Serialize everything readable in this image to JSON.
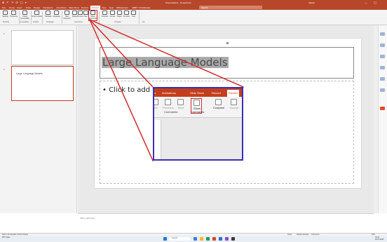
{
  "window": {
    "quick_access": "⊞ ↶ ↷ ⟳ ▢ ▾",
    "doc_title": "Presentation1 - PowerPoint",
    "user": "Sakshi",
    "window_controls": "— ▢ ✕"
  },
  "menu": {
    "tabs": [
      "File",
      "Home",
      "Insert",
      "Draw",
      "Design",
      "Transitions",
      "Animations",
      "Slide Show",
      "Record",
      "Review",
      "View",
      "Help",
      "PDFelement",
      "ABBYY FineReader"
    ],
    "active_index": 9,
    "search_placeholder": "Search"
  },
  "ribbon": {
    "buttons": [
      {
        "label": "Spelling"
      },
      {
        "label": "Thesaurus"
      },
      {
        "label": "Check Accessibility"
      },
      {
        "label": "Smart Lookup"
      },
      {
        "label": "Translate"
      },
      {
        "label": "Language"
      },
      {
        "label": "New Comment"
      },
      {
        "label": "Delete"
      },
      {
        "label": "Previous"
      },
      {
        "label": "Next"
      },
      {
        "label": "Show Comments"
      },
      {
        "label": "Compare"
      },
      {
        "label": "Accept"
      },
      {
        "label": "Reject"
      },
      {
        "label": "Previous"
      },
      {
        "label": "Next"
      }
    ],
    "groups": [
      "Proofing",
      "Accessibility",
      "Insights",
      "Language",
      "Comments",
      "Compare",
      "Ink"
    ]
  },
  "thumbnails": [
    {
      "number": "1",
      "title": ""
    },
    {
      "number": "2",
      "title": "Large Language Models"
    }
  ],
  "slide": {
    "title": "Large Language Models",
    "body": "• Click to add text"
  },
  "notes": {
    "placeholder": "Click to add notes"
  },
  "statusbar": {
    "left": "Slide 2 of 2   English (United States)",
    "notes": "Notes",
    "display": "Display Settings",
    "comments": "Comments",
    "zoom": "93%"
  },
  "taskbar": {
    "search": "Search",
    "weather": "28°C Haze",
    "time": "16:24",
    "date": "29-07-2023"
  },
  "zoom_panel": {
    "tabs": [
      "ns",
      "Animations",
      "Slide Show",
      "Record",
      "Review"
    ],
    "active_index": 4,
    "buttons": [
      {
        "label": "ete"
      },
      {
        "label": "Previous"
      },
      {
        "label": "Next"
      },
      {
        "label": "Show Comments"
      },
      {
        "label": "Compare"
      },
      {
        "label": "Accept"
      }
    ],
    "group": "Comments"
  },
  "colors": {
    "brand": "#b7472a",
    "highlight": "#d12b2b",
    "zoom_border": "#3b2fb8"
  }
}
